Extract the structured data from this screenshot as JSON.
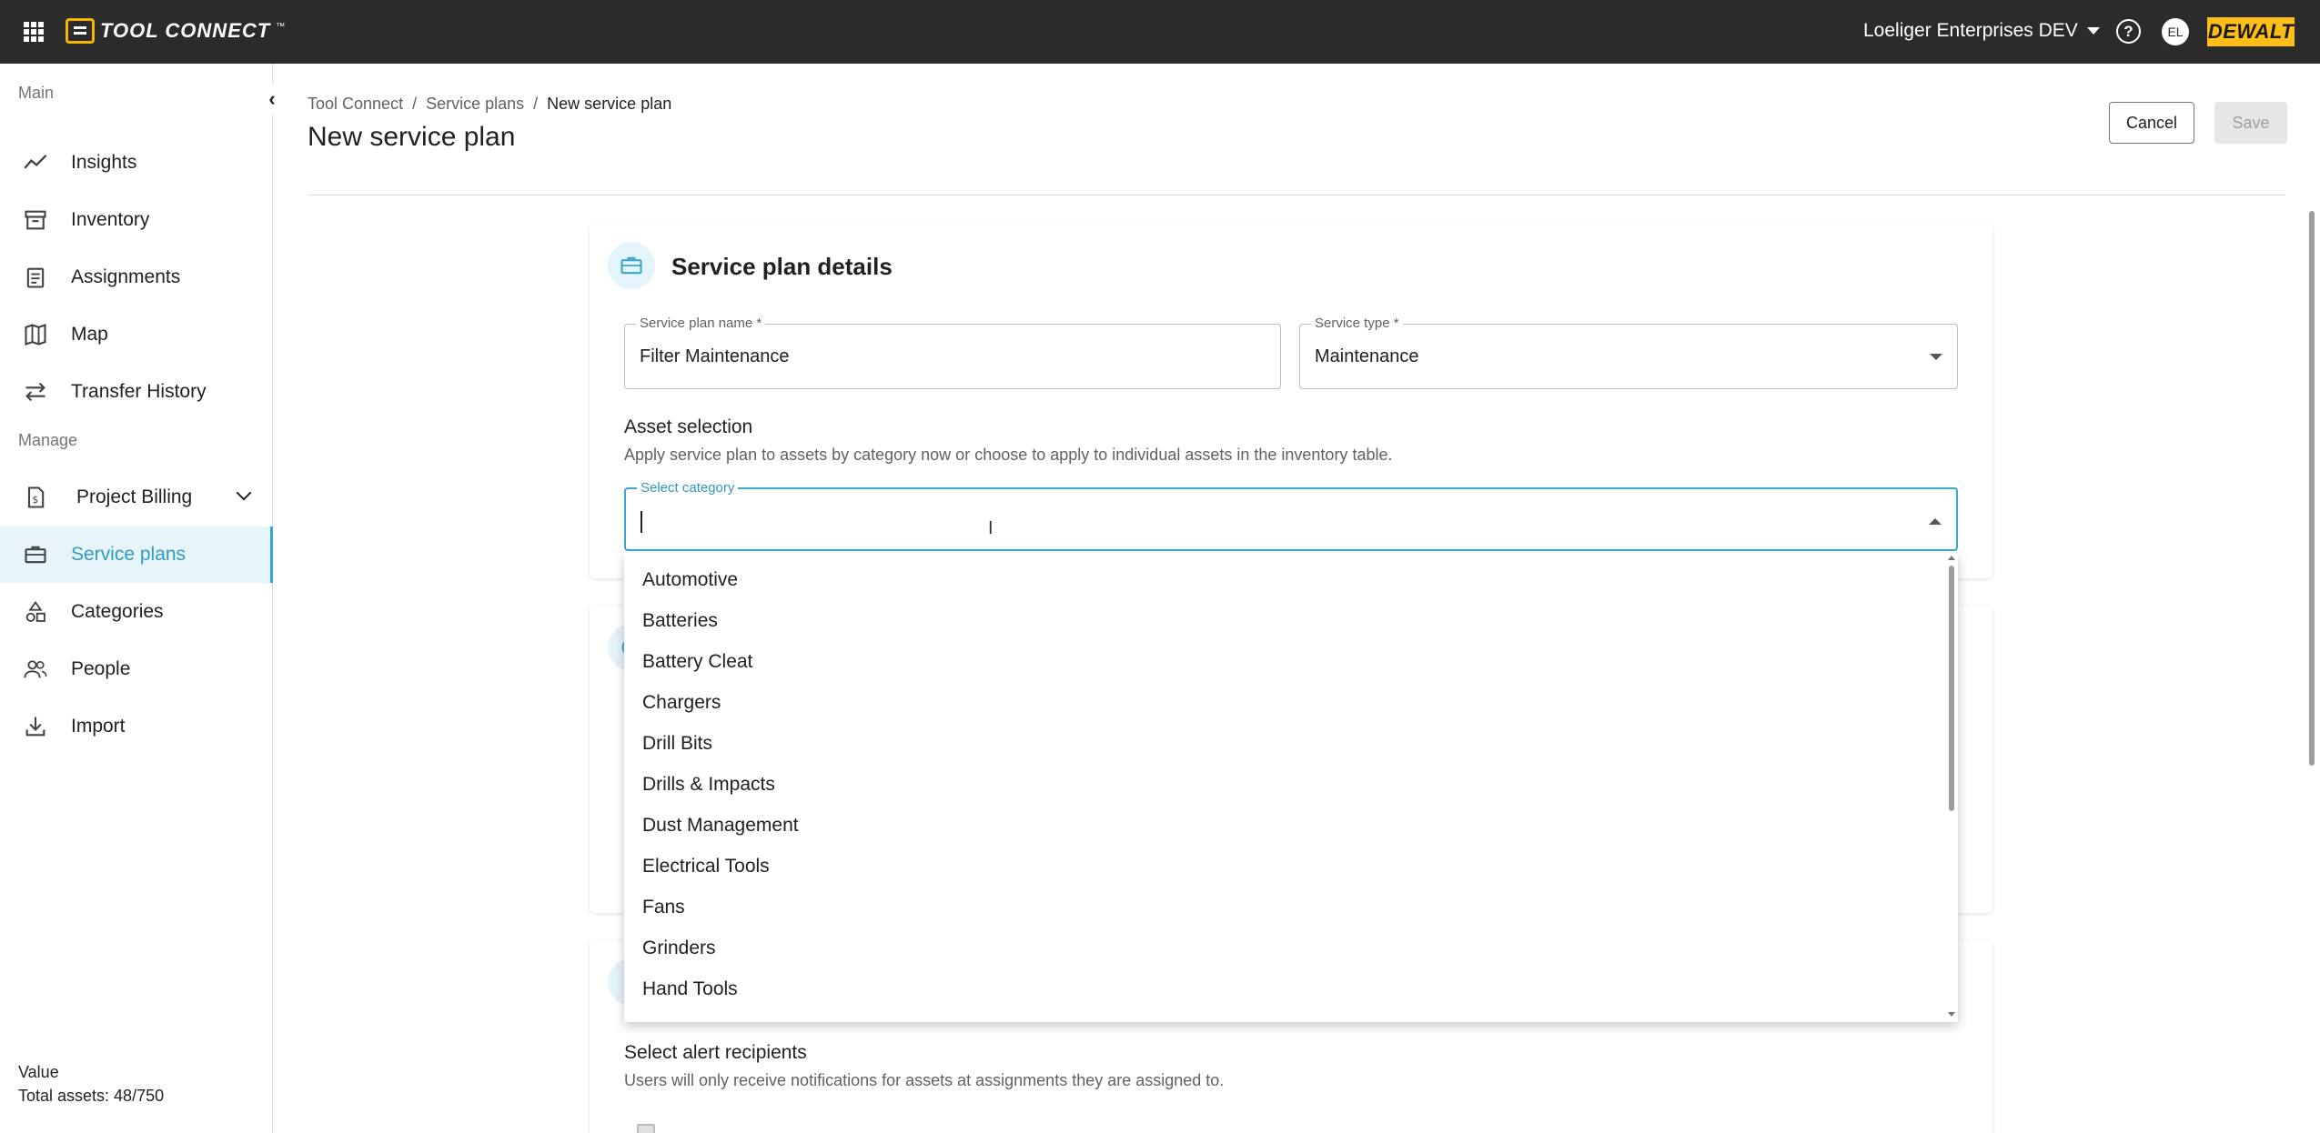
{
  "topbar": {
    "logo_text": "TOOL CONNECT",
    "logo_tm": "™",
    "org_name": "Loeliger Enterprises DEV",
    "help_symbol": "?",
    "avatar_initials": "EL",
    "brand_text": "DEWALT",
    "brand_color": "#febd17"
  },
  "sidebar": {
    "main_label": "Main",
    "manage_label": "Manage",
    "main_items": [
      {
        "label": "Insights",
        "icon": "trending-up-icon"
      },
      {
        "label": "Inventory",
        "icon": "archive-box-icon"
      },
      {
        "label": "Assignments",
        "icon": "clipboard-icon"
      },
      {
        "label": "Map",
        "icon": "map-icon"
      },
      {
        "label": "Transfer History",
        "icon": "transfer-arrows-icon"
      }
    ],
    "manage_items": [
      {
        "label": "Project Billing",
        "icon": "billing-document-icon"
      },
      {
        "label": "Service plans",
        "icon": "toolbox-icon"
      },
      {
        "label": "Categories",
        "icon": "shapes-icon"
      },
      {
        "label": "People",
        "icon": "people-icon"
      },
      {
        "label": "Import",
        "icon": "download-icon"
      }
    ],
    "footer_value_label": "Value",
    "footer_total_assets": "Total assets: 48/750",
    "active_color": "#3aa7cf"
  },
  "header": {
    "breadcrumb": [
      "Tool Connect",
      "Service plans",
      "New service plan"
    ],
    "breadcrumb_sep": "/",
    "title": "New service plan",
    "cancel_label": "Cancel",
    "save_label": "Save"
  },
  "details_card": {
    "title": "Service plan details",
    "plan_name_label": "Service plan name *",
    "plan_name_value": "Filter Maintenance",
    "service_type_label": "Service type *",
    "service_type_value": "Maintenance",
    "asset_selection_heading": "Asset selection",
    "asset_selection_helper": "Apply service plan to assets by category now or choose to apply to individual assets in the inventory table.",
    "category_label": "Select category",
    "category_value": ""
  },
  "category_options": [
    "Automotive",
    "Batteries",
    "Battery Cleat",
    "Chargers",
    "Drill Bits",
    "Drills & Impacts",
    "Dust Management",
    "Electrical Tools",
    "Fans",
    "Grinders",
    "Hand Tools"
  ],
  "alerts_card": {
    "heading": "Select alert recipients",
    "helper": "Users will only receive notifications for assets at assignments they are assigned to."
  }
}
